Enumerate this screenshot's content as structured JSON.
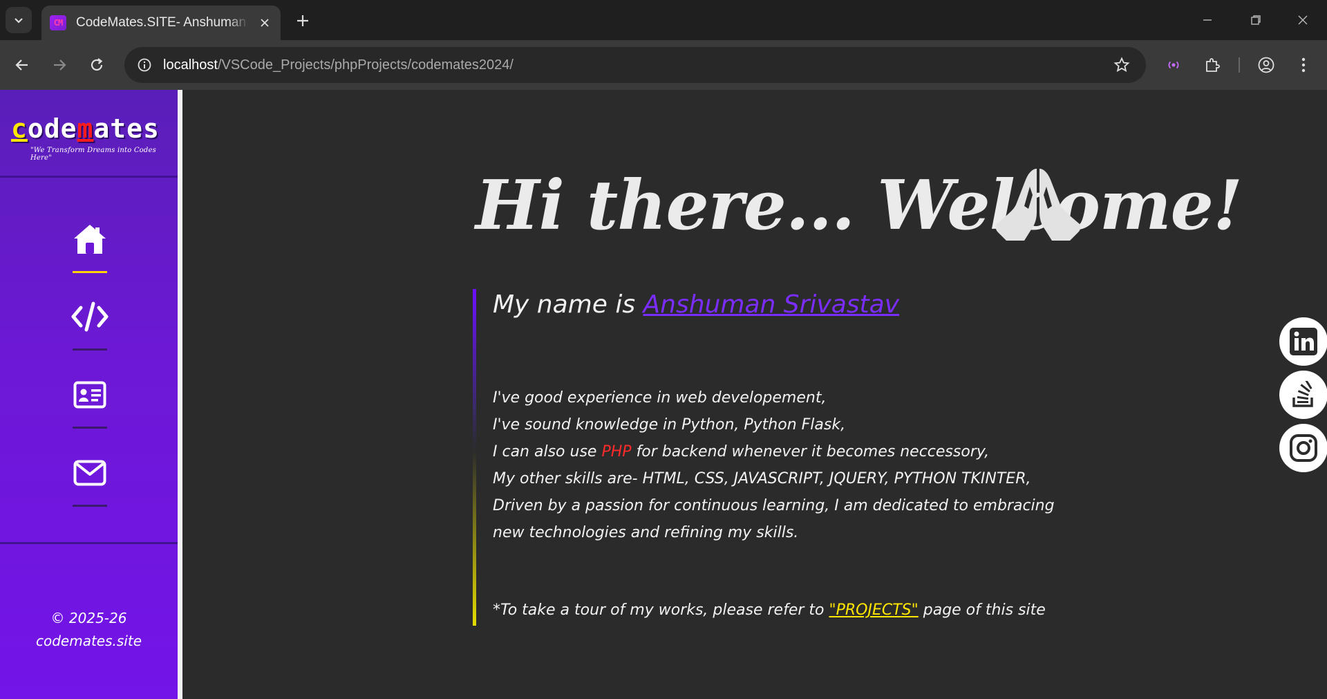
{
  "browser": {
    "tab_title": "CodeMates.SITE- Anshuman Srivastav",
    "favicon_text": "CM",
    "url_host": "localhost",
    "url_path": "/VSCode_Projects/phpProjects/codemates2024/"
  },
  "sidebar": {
    "logo_parts": [
      "c",
      "ode",
      "m",
      "ates"
    ],
    "tagline": "\"We Transform Dreams into Codes Here\"",
    "nav": [
      {
        "name": "home",
        "icon": "home-icon",
        "active": true
      },
      {
        "name": "projects",
        "icon": "code-icon",
        "active": false
      },
      {
        "name": "about",
        "icon": "id-card-icon",
        "active": false
      },
      {
        "name": "contact",
        "icon": "envelope-icon",
        "active": false
      }
    ],
    "copyright_line1": "© 2025-26",
    "copyright_line2": "codemates.site"
  },
  "main": {
    "welcome": "Hi there... Welcome!",
    "name_prefix": "My name is ",
    "name_link": "Anshuman Srivastav",
    "lines": [
      "I've good experience in web developement,",
      "I've sound knowledge in Python, Python Flask,"
    ],
    "php_prefix": "I can also use ",
    "php_word": "PHP",
    "php_suffix": " for backend whenever it becomes neccessory,",
    "skills_line": "My other skills are- HTML, CSS, JAVASCRIPT, JQUERY, PYTHON TKINTER,",
    "passion_line1": "Driven by a passion for continuous learning, I am dedicated to embracing",
    "passion_line2": "new technologies and refining my skills.",
    "tour_prefix": "*To take a tour of my works, please refer to ",
    "tour_link": "\"PROJECTS\"",
    "tour_suffix": " page of this site"
  },
  "social": [
    "linkedin-icon",
    "stackoverflow-icon",
    "instagram-icon"
  ],
  "colors": {
    "sidebar_top": "#5a1fb8",
    "sidebar_bottom": "#7314e8",
    "accent_yellow": "#ffe600",
    "accent_red": "#ff2b2b",
    "link_purple": "#7b2cff",
    "background": "#2b2b2b"
  }
}
